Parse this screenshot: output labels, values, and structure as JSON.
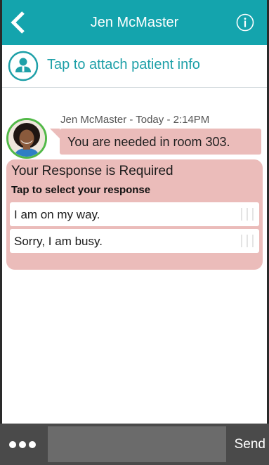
{
  "header": {
    "title": "Jen McMaster",
    "back_icon": "chevron-left-icon",
    "info_icon": "info-circle-icon",
    "background_color": "#14a4ad"
  },
  "attach": {
    "label": "Tap to attach patient info",
    "icon": "patient-icon",
    "accent_color": "#1ea0a8"
  },
  "message": {
    "sender": "Jen McMaster",
    "date": "Today",
    "time": "2:14PM",
    "sender_line": "Jen McMaster - Today - 2:14PM",
    "text": "You are needed in room 303.",
    "bubble_color": "#ebbcba",
    "avatar_border_color": "#52b948"
  },
  "response": {
    "title": "Your Response is Required",
    "subtitle": "Tap to select your response",
    "options": [
      {
        "label": "I am on my way."
      },
      {
        "label": "Sorry, I am busy."
      }
    ]
  },
  "compose": {
    "placeholder": "",
    "send_label": "Send",
    "more_icon": "more-dots-icon"
  }
}
